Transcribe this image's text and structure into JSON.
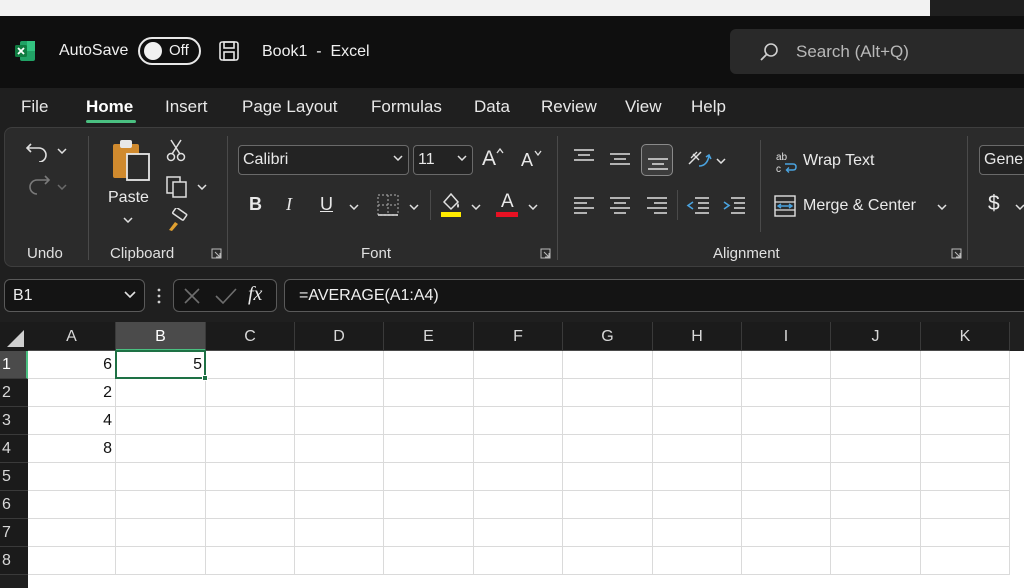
{
  "app": {
    "autosave_label": "AutoSave",
    "autosave_state": "Off",
    "doc_title": "Book1  -  Excel",
    "search_placeholder": "Search (Alt+Q)",
    "accent_color": "#4ac081",
    "excel_green": "#1e7145"
  },
  "tabs": [
    {
      "label": "File"
    },
    {
      "label": "Home",
      "active": true
    },
    {
      "label": "Insert"
    },
    {
      "label": "Page Layout"
    },
    {
      "label": "Formulas"
    },
    {
      "label": "Data"
    },
    {
      "label": "Review"
    },
    {
      "label": "View"
    },
    {
      "label": "Help"
    }
  ],
  "ribbon": {
    "groups": {
      "undo": "Undo",
      "clipboard": "Clipboard",
      "font": "Font",
      "alignment": "Alignment"
    },
    "paste_label": "Paste",
    "font_name": "Calibri",
    "font_size": "11",
    "bold": "B",
    "italic": "I",
    "underline": "U",
    "grow_font": "A",
    "shrink_font": "A",
    "font_color_letter": "A",
    "wrap_text": "Wrap Text",
    "merge_center": "Merge & Center",
    "number_format": "General",
    "currency": "$",
    "icons": [
      "undo-icon",
      "redo-icon",
      "cut-icon",
      "copy-icon",
      "format-painter-icon",
      "paste-icon",
      "borders-icon",
      "fill-color-icon",
      "orientation-icon",
      "indent-icon"
    ]
  },
  "formula_bar": {
    "name_box": "B1",
    "fx": "fx",
    "formula": "=AVERAGE(A1:A4)"
  },
  "grid": {
    "columns": [
      "A",
      "B",
      "C",
      "D",
      "E",
      "F",
      "G",
      "H",
      "I",
      "J",
      "K"
    ],
    "rows": [
      "1",
      "2",
      "3",
      "4",
      "5",
      "6",
      "7",
      "8"
    ],
    "selected_cell": "B1",
    "values": {
      "A1": "6",
      "B1": "5",
      "A2": "2",
      "A3": "4",
      "A4": "8"
    }
  }
}
